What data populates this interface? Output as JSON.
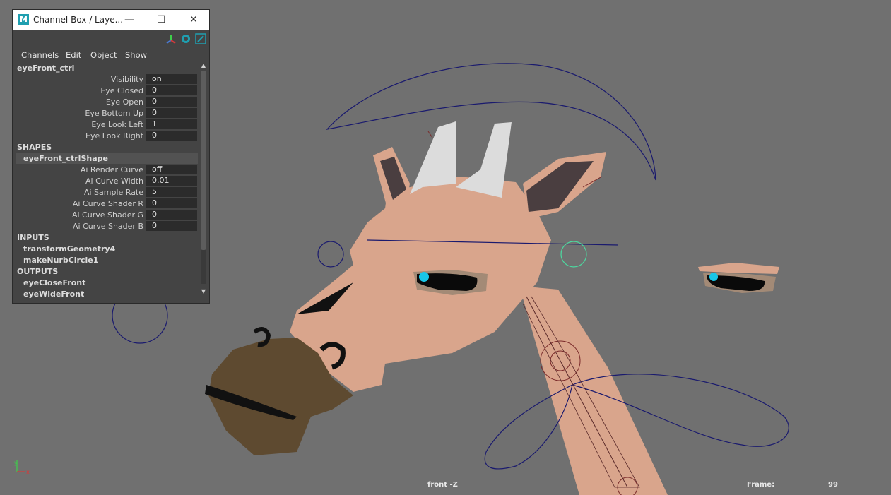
{
  "window": {
    "title": "Channel Box / Laye...",
    "logo_letter": "M",
    "minimize": "—",
    "maximize": "☐",
    "close": "✕"
  },
  "toolbar_icons": [
    "axis-transform-icon",
    "channel-sync-icon",
    "pin-arrow-icon"
  ],
  "menu": [
    "Channels",
    "Edit",
    "Object",
    "Show"
  ],
  "object_name": "eyeFront_ctrl",
  "attributes": [
    {
      "label": "Visibility",
      "value": "on"
    },
    {
      "label": "Eye Closed",
      "value": "0"
    },
    {
      "label": "Eye Open",
      "value": "0"
    },
    {
      "label": "Eye Bottom Up",
      "value": "0"
    },
    {
      "label": "Eye Look Left",
      "value": "1"
    },
    {
      "label": "Eye Look Right",
      "value": "0"
    }
  ],
  "shapes": {
    "header": "SHAPES",
    "name": "eyeFront_ctrlShape",
    "attributes": [
      {
        "label": "Ai Render Curve",
        "value": "off"
      },
      {
        "label": "Ai Curve Width",
        "value": "0.01"
      },
      {
        "label": "Ai Sample Rate",
        "value": "5"
      },
      {
        "label": "Ai Curve Shader R",
        "value": "0"
      },
      {
        "label": "Ai Curve Shader G",
        "value": "0"
      },
      {
        "label": "Ai Curve Shader B",
        "value": "0"
      }
    ]
  },
  "inputs": {
    "header": "INPUTS",
    "items": [
      "transformGeometry4",
      "makeNurbCircle1"
    ]
  },
  "outputs": {
    "header": "OUTPUTS",
    "items": [
      "eyeCloseFront",
      "eyeWideFront"
    ]
  },
  "viewport": {
    "camera_label": "front -Z",
    "frame_label": "Frame:",
    "frame_value": "99",
    "axis": {
      "y": "y",
      "x": "x"
    }
  },
  "colors": {
    "viewport_bg": "#707070",
    "skin": "#d9a58c",
    "snout": "#5e4a30",
    "horn": "#dcdcdc",
    "ear_inner": "#4a3e40",
    "nurbs_curve": "#1a1a6e",
    "selected_curve": "#4dd9a0",
    "eye_iris": "#19c6e8"
  }
}
